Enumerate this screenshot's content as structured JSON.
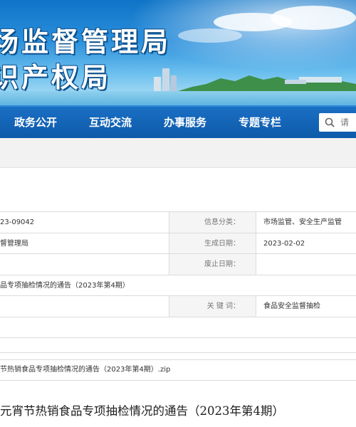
{
  "banner": {
    "title_line1": "场监督管理局",
    "title_line2": "识产权局"
  },
  "nav": {
    "items": [
      "政务公开",
      "互动交流",
      "办事服务",
      "专题专栏"
    ],
    "search_placeholder": "请"
  },
  "info": {
    "index_number": "23-09042",
    "category_label": "信息分类：",
    "category_value": "市场监管、安全生产监管",
    "publisher": "督管理局",
    "created_label": "生成日期：",
    "created_value": "2023-02-02",
    "expiry_label": "废止日期：",
    "expiry_value": "",
    "name": "品专项抽检情况的通告（2023年第4期）",
    "keywords_label": "关 键 词：",
    "keywords_value": "食品安全监督抽检"
  },
  "attachment": {
    "filename": "节热销食品专项抽检情况的通告（2023年第4期）.zip"
  },
  "article": {
    "title": "元宵节热销食品专项抽检情况的通告（2023年第4期）"
  }
}
